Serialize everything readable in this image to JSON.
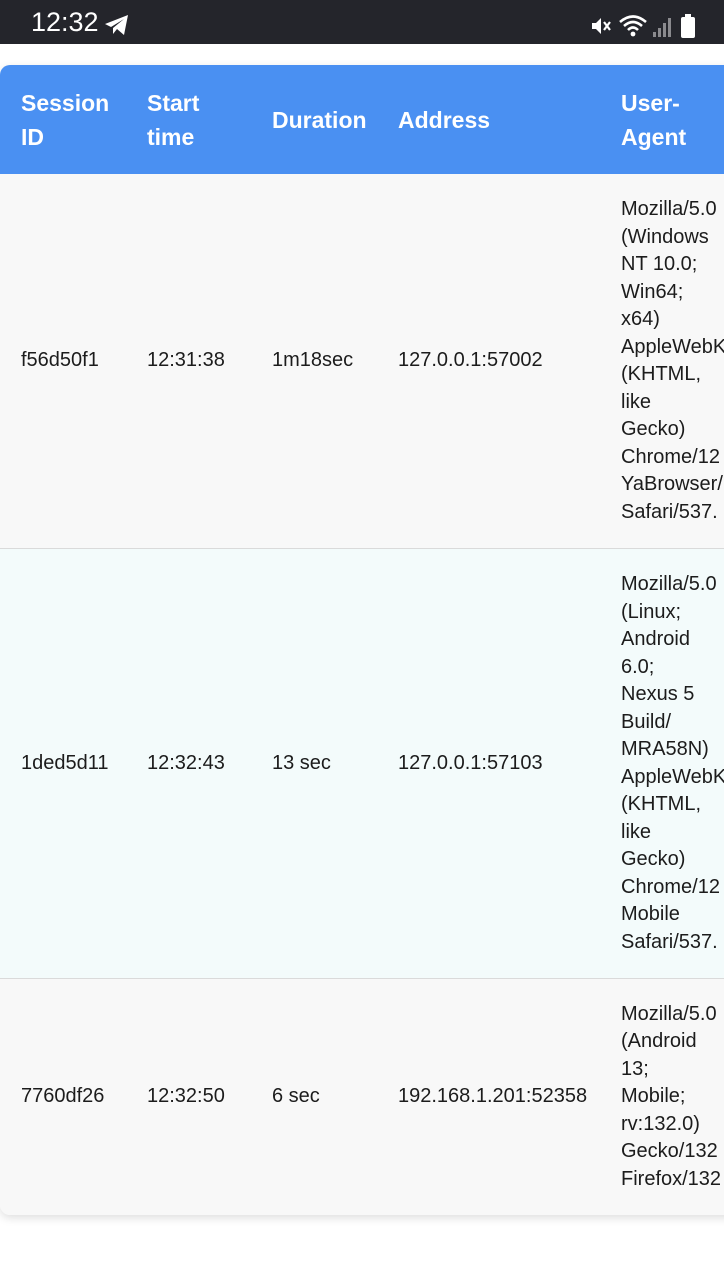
{
  "status_bar": {
    "time": "12:32",
    "icons": [
      "telegram-icon",
      "mute-icon",
      "wifi-icon",
      "signal-icon",
      "battery-icon"
    ]
  },
  "colors": {
    "status_bar_bg": "#24252b",
    "header_bg": "#4a90f2",
    "row_bg_even": "#f8f8f8",
    "row_bg_odd": "#f3fbfb"
  },
  "table": {
    "headers": {
      "session_id": [
        "Session",
        "ID"
      ],
      "start_time": [
        "Start",
        "time"
      ],
      "duration": "Duration",
      "address": "Address",
      "user_agent": [
        "User-",
        "Agent"
      ]
    },
    "rows": [
      {
        "session_id": "f56d50f1",
        "start_time": "12:31:38",
        "duration": "1m18sec",
        "address": "127.0.0.1:57002",
        "user_agent": [
          "Mozilla/5.0",
          "(Windows",
          "NT 10.0;",
          "Win64;",
          "x64)",
          "AppleWebK",
          "(KHTML,",
          "like",
          "Gecko)",
          "Chrome/12",
          "YaBrowser/",
          "Safari/537."
        ]
      },
      {
        "session_id": "1ded5d11",
        "start_time": "12:32:43",
        "duration": "13 sec",
        "address": "127.0.0.1:57103",
        "user_agent": [
          "Mozilla/5.0",
          "(Linux;",
          "Android",
          "6.0;",
          "Nexus 5",
          "Build/",
          "MRA58N)",
          "AppleWebK",
          "(KHTML,",
          "like",
          "Gecko)",
          "Chrome/12",
          "Mobile",
          "Safari/537."
        ]
      },
      {
        "session_id": "7760df26",
        "start_time": "12:32:50",
        "duration": "6 sec",
        "address": "192.168.1.201:52358",
        "user_agent": [
          "Mozilla/5.0",
          "(Android",
          "13;",
          "Mobile;",
          "rv:132.0)",
          "Gecko/132",
          "Firefox/132"
        ]
      }
    ]
  }
}
